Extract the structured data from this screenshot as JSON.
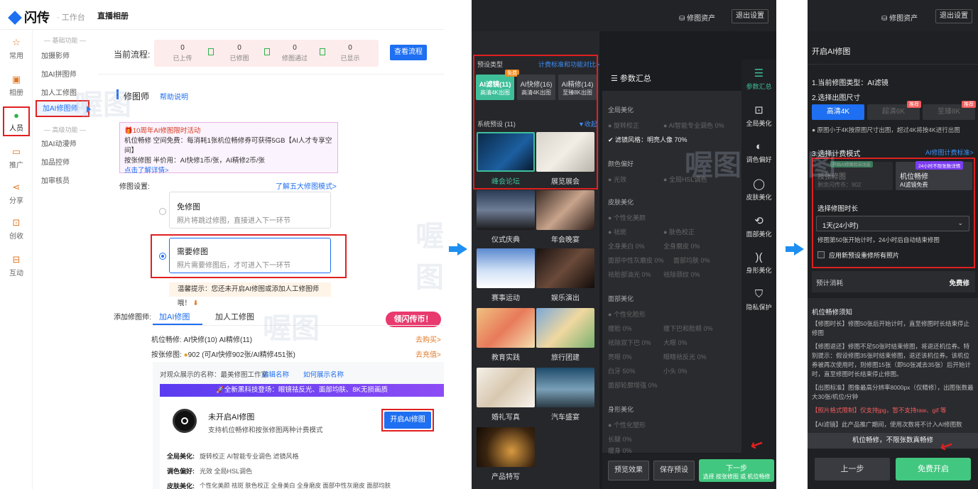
{
  "panel1": {
    "logo": "闪传",
    "logo_sub": "· 工作台",
    "page_title": "直播相册",
    "left_nav": [
      "常用",
      "相册",
      "人员",
      "推广",
      "分享",
      "创收",
      "互动"
    ],
    "sub_nav": {
      "basic_header": "— 基础功能 —",
      "basic": [
        "加摄影师",
        "加AI拼图师",
        "加人工修图",
        "加AI修图师"
      ],
      "advanced_header": "— 高级功能 —",
      "advanced": [
        "加AI动漫师",
        "加品控师",
        "加审核员"
      ]
    },
    "flow_label": "当前流程:",
    "flow_steps": [
      {
        "count": "0",
        "label": "已上传"
      },
      {
        "count": "0",
        "label": "已修图"
      },
      {
        "count": "0",
        "label": "修图通过"
      },
      {
        "count": "0",
        "label": "已显示"
      }
    ],
    "view_flow_button": "查看流程",
    "section_title": "修图师",
    "help_link": "帮助说明",
    "promo": {
      "title": "10周年AI修图限时活动",
      "line1": "机位畅修 空间免费：每消耗1张机位畅修券可获得5GB【AI人才专享空间】",
      "line2": "按张修图 半价用：AI快修1币/张，AI精修2币/张",
      "link": "点击了解详情>"
    },
    "retouch_settings_label": "修图设置:",
    "five_modes_link": "了解五大修图模式>",
    "option_free": {
      "title": "免修图",
      "desc": "照片将跳过修图，直接进入下一环节"
    },
    "option_need": {
      "title": "需要修图",
      "desc": "照片需要修图后，才可进入下一环节"
    },
    "warning": "温馨提示：您还未开启AI修图或添加人工修图师哦！",
    "add_retoucher_label": "添加修图师:",
    "tabs": [
      "加AI修图",
      "加人工修图"
    ],
    "badge": "领闪传币！",
    "machine_line": "机位畅修:  AI快修(10)  AI精修(11)",
    "buy_link": "去购买>",
    "perpic_line_prefix": "按张修图:",
    "perpic_coins": "902",
    "perpic_detail": "(可AI快修902张/AI精修451张)",
    "recharge_link": "去充值>",
    "display_name_line": "对观众展示的名称：最美修图工作室",
    "edit_name": "编辑名称",
    "how_display": "如何展示名称",
    "banner": "全新黑科技登场：眼镜祛反光、面部均肤、8K无损画质",
    "ai_status_title": "未开启AI修图",
    "ai_status_desc": "支持机位畅修和按张修图两种计费模式",
    "enable_ai_button": "开启AI修图",
    "feature_rows": [
      {
        "label": "全局美化:",
        "items": "旋转校正    AI智能专业调色    滤镜风格"
      },
      {
        "label": "调色偏好:",
        "items": "光效    全局HSL调色"
      },
      {
        "label": "皮肤美化:",
        "items": "个性化美颜    祛斑    肤色校正    全身美白    全身磨皮    面部中性灰磨皮    面部均肤"
      }
    ]
  },
  "panel2": {
    "assets": "修图资产",
    "exit": "退出设置",
    "preset_title": "预设",
    "preset_type": "预设类型",
    "compare_link": "计费标准和功能对比>",
    "free_tag": "免费",
    "types": [
      {
        "name": "AI滤镜(11)",
        "sub": "高清4K出图"
      },
      {
        "name": "AI快修(16)",
        "sub": "高清4K出图"
      },
      {
        "name": "AI精修(14)",
        "sub": "至臻8K出图"
      }
    ],
    "system_presets": "系统预设 (11)",
    "collapse": "收起",
    "thumbs": [
      "峰会论坛",
      "展览展会",
      "仪式庆典",
      "年会晚宴",
      "赛事运动",
      "娱乐演出",
      "教育实践",
      "旅行团建",
      "婚礼写真",
      "汽车盛宴",
      "产品特写"
    ],
    "summary_title": "参数汇总",
    "sections": [
      {
        "name": "全局美化",
        "opts": [
          "旋转校正",
          "AI智能专业调色 0%"
        ],
        "active": "滤镜风格：明亮人像 70%"
      },
      {
        "name": "颜色偏好",
        "opts": [
          "光效",
          "全局HSL调色"
        ]
      },
      {
        "name": "皮肤美化",
        "opts": [
          "个性化美颜",
          "祛斑",
          "肤色校正",
          "全身美白 0%",
          "全身磨皮 0%",
          "面部中性灰磨皮 0%",
          "面部均肤 0%",
          "祛脸部油光 0%",
          "祛除颈纹 0%"
        ]
      },
      {
        "name": "面部美化",
        "opts": [
          "个性化脸形",
          "瘦脸 0%",
          "瘦下巴和脸颊 0%",
          "祛除双下巴 0%",
          "大眼 0%",
          "亮眼 0%",
          "眼睛祛反光 0%",
          "白牙 50%",
          "小头 0%",
          "面部轮廓增强 0%"
        ]
      },
      {
        "name": "身形美化",
        "opts": [
          "个性化塑形",
          "长腿 0%",
          "瘦身 0%"
        ]
      }
    ],
    "right_tabs": [
      "参数汇总",
      "全局美化",
      "调色偏好",
      "皮肤美化",
      "面部美化",
      "身形美化",
      "隐私保护"
    ],
    "preview_btn": "预览效果",
    "save_btn": "保存预设",
    "next_btn": "下一步",
    "next_sub": "选择 按张修图 或 机位畅修"
  },
  "panel3": {
    "assets": "修图资产",
    "exit": "退出设置",
    "title": "开启AI修图",
    "step1": "1.当前修图类型：AI滤镜",
    "step2": "2.选择出图尺寸",
    "sizes": [
      "高清4K",
      "超清6K",
      "至臻8K"
    ],
    "hot_tag": "推荐",
    "size_note": "原图小于4K按原图尺寸出图，超过4K将按4K进行出图",
    "step3": "3.选择计费模式",
    "billing_link": "AI修图计费标准>",
    "mode_perpic": {
      "title": "按张修图",
      "sub": "剩余闪传币：902",
      "tag": "开始AI修图后自动选"
    },
    "mode_machine": {
      "title": "机位畅修",
      "sub": "AI滤镜免费",
      "tag": "24小时不限张数详情"
    },
    "duration_label": "选择修图时长",
    "duration_value": "1天(24小时)",
    "duration_note": "修图第50张开始计时，24小时后自动结束修图",
    "apply_all": "应用新预设重修所有照片",
    "cost_label": "预计消耗",
    "cost_value": "免费修",
    "notes_title": "机位畅修须知",
    "notes": [
      "【修图时长】修图50张后开始计时，直至修图时长结束停止修图",
      "【修图退还】修图不足50张时结束修图，将退还机位券。特别提示：假设修图35张时结束修图，退还该机位券。该机位券被再次使用时，则修图15张（即50张减去35张）后开始计时，直至修图时长结束停止修图。",
      "【出图标准】图像最高分辨率8000px（仅精修），出图张数最大30张/机位/分钟"
    ],
    "notes_red": "【照片格式限制】仅支持jpg，暂不支持raw、gif 等",
    "notes_last": "【AI滤镜】此产品推广期间，使用次数将不计入AI修图数",
    "free_banner": "机位畅修，不限张数真畅修",
    "prev_btn": "上一步",
    "start_btn": "免费开启"
  },
  "watermark": "喔图",
  "colors": {
    "accent": "#1e6ff1",
    "green": "#41c77f",
    "red": "#e02020",
    "orange": "#e07a28"
  }
}
